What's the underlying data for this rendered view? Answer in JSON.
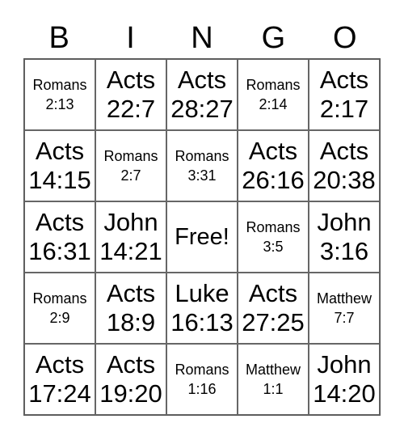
{
  "header": [
    "B",
    "I",
    "N",
    "G",
    "O"
  ],
  "cells": [
    [
      {
        "book": "Romans",
        "ref": "2:13",
        "size": "small"
      },
      {
        "book": "Acts",
        "ref": "22:7",
        "size": "large"
      },
      {
        "book": "Acts",
        "ref": "28:27",
        "size": "large"
      },
      {
        "book": "Romans",
        "ref": "2:14",
        "size": "small"
      },
      {
        "book": "Acts",
        "ref": "2:17",
        "size": "large"
      }
    ],
    [
      {
        "book": "Acts",
        "ref": "14:15",
        "size": "large"
      },
      {
        "book": "Romans",
        "ref": "2:7",
        "size": "small"
      },
      {
        "book": "Romans",
        "ref": "3:31",
        "size": "small"
      },
      {
        "book": "Acts",
        "ref": "26:16",
        "size": "large"
      },
      {
        "book": "Acts",
        "ref": "20:38",
        "size": "large"
      }
    ],
    [
      {
        "book": "Acts",
        "ref": "16:31",
        "size": "large"
      },
      {
        "book": "John",
        "ref": "14:21",
        "size": "large"
      },
      {
        "book": "Free!",
        "ref": "",
        "size": "free"
      },
      {
        "book": "Romans",
        "ref": "3:5",
        "size": "small"
      },
      {
        "book": "John",
        "ref": "3:16",
        "size": "large"
      }
    ],
    [
      {
        "book": "Romans",
        "ref": "2:9",
        "size": "small"
      },
      {
        "book": "Acts",
        "ref": "18:9",
        "size": "large"
      },
      {
        "book": "Luke",
        "ref": "16:13",
        "size": "large"
      },
      {
        "book": "Acts",
        "ref": "27:25",
        "size": "large"
      },
      {
        "book": "Matthew",
        "ref": "7:7",
        "size": "small"
      }
    ],
    [
      {
        "book": "Acts",
        "ref": "17:24",
        "size": "large"
      },
      {
        "book": "Acts",
        "ref": "19:20",
        "size": "large"
      },
      {
        "book": "Romans",
        "ref": "1:16",
        "size": "small"
      },
      {
        "book": "Matthew",
        "ref": "1:1",
        "size": "small"
      },
      {
        "book": "John",
        "ref": "14:20",
        "size": "large"
      }
    ]
  ]
}
